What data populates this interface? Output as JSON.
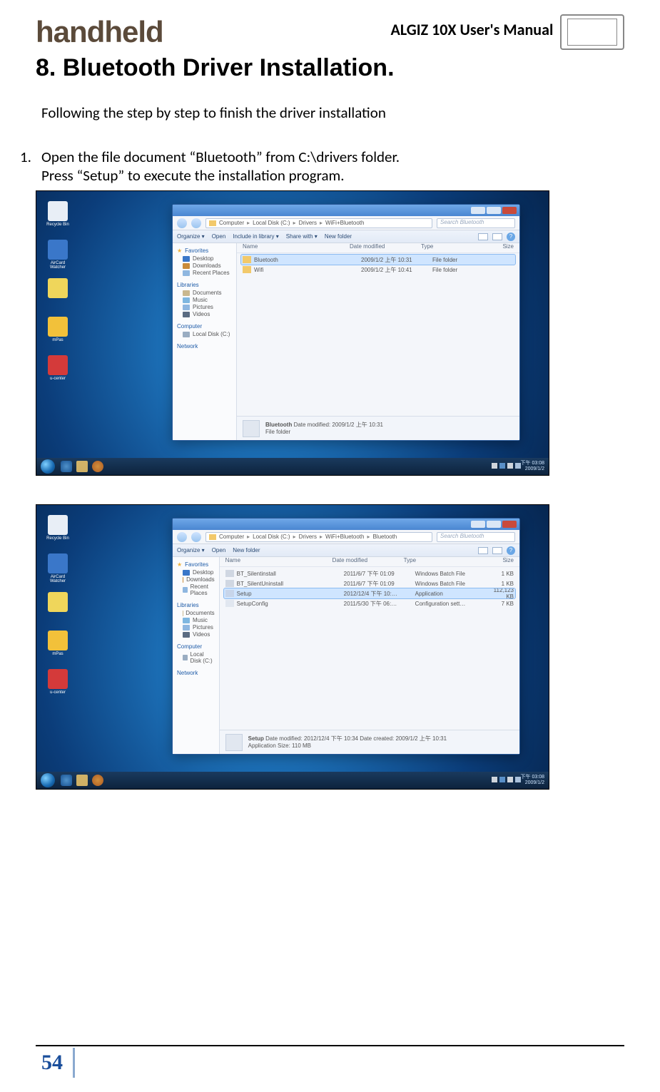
{
  "header": {
    "brand": "handheld",
    "manual_title": "ALGIZ 10X User's Manual"
  },
  "section": {
    "number": "8.",
    "title": "Bluetooth Driver Installation."
  },
  "intro": "Following the step by step to finish the driver installation",
  "step1": {
    "num": "1.",
    "line1": "Open the file document “Bluetooth” from C:\\drivers folder.",
    "line2": "Press “Setup” to execute the installation program."
  },
  "desktop_icons": [
    {
      "label": "Recycle Bin",
      "color": "#e8eef6"
    },
    {
      "label": "AirCard Watcher",
      "color": "#3a77c9"
    },
    {
      "label": "",
      "color": "#efd65b"
    },
    {
      "label": "mPas",
      "color": "#f2c13a"
    },
    {
      "label": "u-center",
      "color": "#d43a3a"
    }
  ],
  "tray": {
    "time": "下午 03:08",
    "date": "2009/1/2"
  },
  "explorer_common": {
    "toolbar": {
      "organize": "Organize ▾",
      "open": "Open",
      "include": "Include in library ▾",
      "share": "Share with ▾",
      "newfolder": "New folder"
    },
    "nav": {
      "favorites": "Favorites",
      "fav_items": [
        {
          "label": "Desktop",
          "color": "#3a77c9"
        },
        {
          "label": "Downloads",
          "color": "#c98b3a"
        },
        {
          "label": "Recent Places",
          "color": "#8fb7e0"
        }
      ],
      "libraries": "Libraries",
      "lib_items": [
        {
          "label": "Documents",
          "color": "#c9b88f"
        },
        {
          "label": "Music",
          "color": "#7fb7e0"
        },
        {
          "label": "Pictures",
          "color": "#8fb7e0"
        },
        {
          "label": "Videos",
          "color": "#5a6b82"
        }
      ],
      "computer": "Computer",
      "comp_items": [
        {
          "label": "Local Disk (C:)",
          "color": "#9aadc2"
        }
      ],
      "network": "Network"
    },
    "columns": {
      "name": "Name",
      "date": "Date modified",
      "type": "Type",
      "size": "Size"
    },
    "search_placeholder": "Search Bluetooth"
  },
  "screenshot1": {
    "breadcrumb": [
      "Computer",
      "Local Disk (C:)",
      "Drivers",
      "WiFi+Bluetooth"
    ],
    "rows": [
      {
        "name": "Bluetooth",
        "date": "2009/1/2 上午 10:31",
        "type": "File folder",
        "size": "",
        "icon": "#f2c96b",
        "sel": true
      },
      {
        "name": "Wifi",
        "date": "2009/1/2 上午 10:41",
        "type": "File folder",
        "size": "",
        "icon": "#f2c96b",
        "sel": false
      }
    ],
    "details": {
      "title": "Bluetooth",
      "line1": "Date modified: 2009/1/2 上午 10:31",
      "line2": "File folder"
    }
  },
  "screenshot2": {
    "breadcrumb": [
      "Computer",
      "Local Disk (C:)",
      "Drivers",
      "WiFi+Bluetooth",
      "Bluetooth"
    ],
    "rows": [
      {
        "name": "BT_Silentinstall",
        "date": "2011/6/7 下午 01:09",
        "type": "Windows Batch File",
        "size": "1 KB",
        "icon": "#d0d7e2",
        "sel": false
      },
      {
        "name": "BT_SilentUninstall",
        "date": "2011/6/7 下午 01:09",
        "type": "Windows Batch File",
        "size": "1 KB",
        "icon": "#d0d7e2",
        "sel": false
      },
      {
        "name": "Setup",
        "date": "2012/12/4 下午 10:…",
        "type": "Application",
        "size": "112,123 KB",
        "icon": "#c7d5ea",
        "sel": true
      },
      {
        "name": "SetupConfig",
        "date": "2011/5/30 下午 06:…",
        "type": "Configuration sett…",
        "size": "7 KB",
        "icon": "#e1e7f0",
        "sel": false
      }
    ],
    "details": {
      "title": "Setup",
      "line1": "Date modified: 2012/12/4 下午 10:34    Date created: 2009/1/2 上午 10:31",
      "line2": "Application    Size: 110 MB"
    }
  },
  "page_number": "54"
}
